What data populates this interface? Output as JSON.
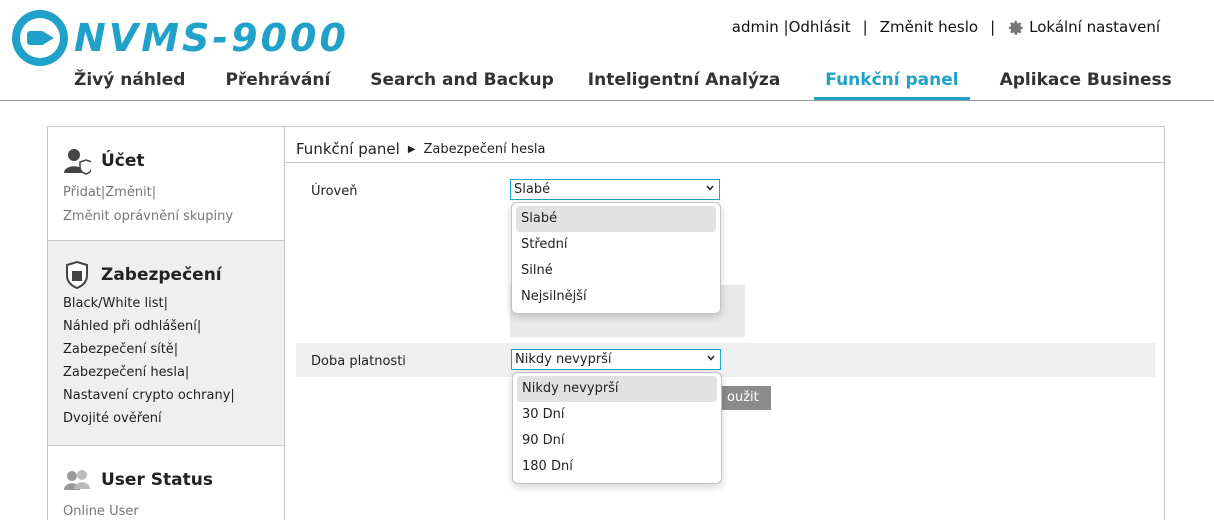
{
  "header": {
    "logo_text": "NVMS-9000",
    "user": "admin",
    "logout": "Odhlásit",
    "change_password": "Změnit heslo",
    "local_settings": "Lokální nastavení",
    "separator": "|"
  },
  "nav": {
    "tabs": [
      {
        "label": "Živý náhled"
      },
      {
        "label": "Přehrávání"
      },
      {
        "label": "Search and Backup"
      },
      {
        "label": "Inteligentní Analýza"
      },
      {
        "label": "Funkční panel",
        "active": true
      },
      {
        "label": "Aplikace Business"
      }
    ]
  },
  "sidebar": {
    "account": {
      "title": "Účet",
      "links": [
        "Přidat|Změnit|",
        "Změnit oprávnění skupiny"
      ]
    },
    "security": {
      "title": "Zabezpečení",
      "links": [
        "Black/White list|",
        "Náhled při odhlášení|",
        "Zabezpečení sítě|",
        "Zabezpečení hesla|",
        "Nastavení crypto ochrany|",
        "Dvojité ověření"
      ]
    },
    "user_status": {
      "title": "User Status",
      "links": [
        "Online User"
      ]
    }
  },
  "breadcrumb": {
    "root": "Funkční panel",
    "current": "Zabezpečení hesla"
  },
  "form": {
    "level": {
      "label": "Úroveň",
      "value": "Slabé",
      "options": [
        "Slabé",
        "Střední",
        "Silné",
        "Nejsilnější"
      ]
    },
    "validity": {
      "label": "Doba platnosti",
      "value": "Nikdy nevyprší",
      "options": [
        "Nikdy nevyprší",
        "30 Dní",
        "90 Dní",
        "180 Dní"
      ]
    },
    "apply_button": "oužit"
  },
  "colors": {
    "accent": "#1fa1c9",
    "button_gray": "#8c8c8c",
    "panel_gray": "#efefef"
  }
}
